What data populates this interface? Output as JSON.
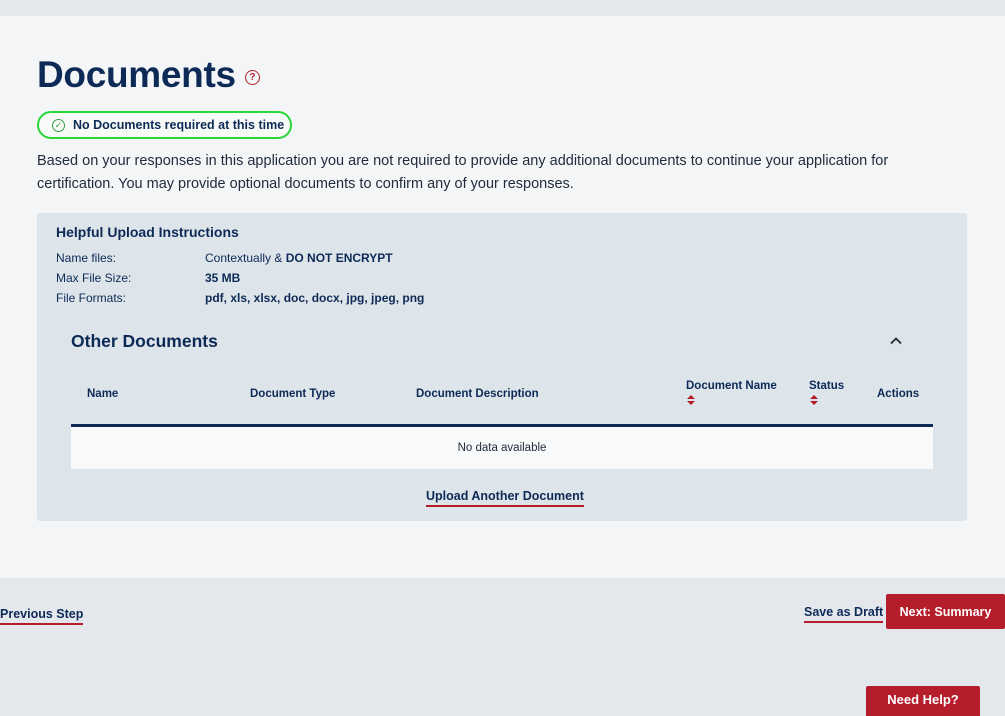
{
  "page": {
    "title": "Documents",
    "help_icon_glyph": "?"
  },
  "badge": {
    "icon": "check-circle-icon",
    "text": "No Documents required at this time"
  },
  "intro": {
    "line1": "Based on your responses in this application you are not required to provide any additional documents to continue your application for",
    "line2": "certification. You may provide optional documents to confirm any of your responses."
  },
  "instructions": {
    "heading": "Helpful Upload Instructions",
    "rows": [
      {
        "label": "Name files:",
        "value_prefix": "Contextually & ",
        "value_strong": "DO NOT ENCRYPT"
      },
      {
        "label": "Max File Size:",
        "value_prefix": "",
        "value_strong": "35 MB"
      },
      {
        "label": "File Formats:",
        "value_prefix": "",
        "value_strong": "pdf, xls, xlsx, doc, docx, jpg, jpeg, png"
      }
    ]
  },
  "other_documents": {
    "title": "Other Documents",
    "collapse_icon": "chevron-up-icon",
    "columns": [
      "Name",
      "Document Type",
      "Document Description",
      "Document Name",
      "Status",
      "Actions"
    ],
    "sortable_icon": "sort-icon",
    "empty_text": "No data available",
    "upload_link": "Upload Another Document"
  },
  "footer": {
    "previous": "Previous Step",
    "save_draft": "Save as Draft",
    "next": "Next: Summary",
    "need_help": "Need Help?"
  },
  "colors": {
    "navy": "#0d2a57",
    "accent_red": "#b51d2a",
    "success_green": "#2ad63a"
  }
}
